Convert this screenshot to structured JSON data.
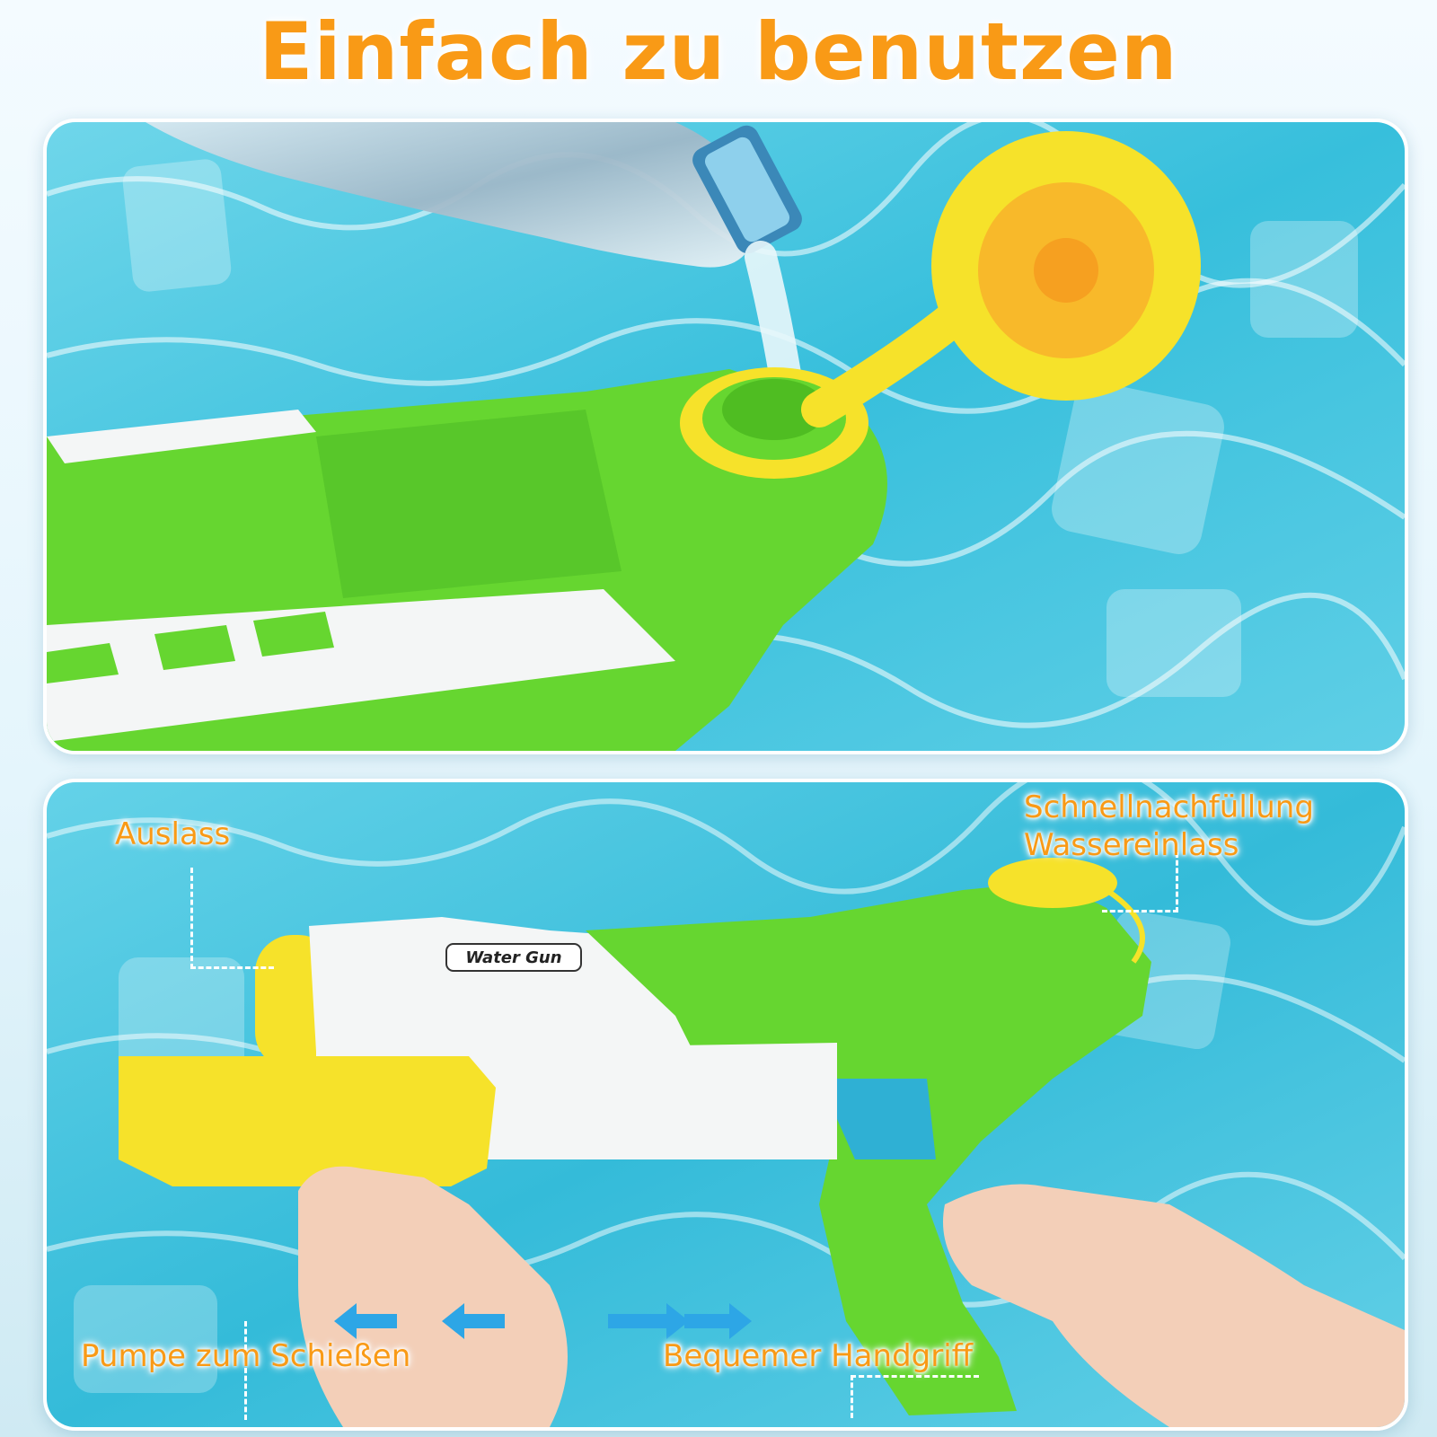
{
  "title": "Einfach zu benutzen",
  "badge_text": "Water Gun",
  "labels": {
    "outlet": "Auslass",
    "refill_line1": "Schnellnachfüllung",
    "refill_line2": "Wassereinlass",
    "pump": "Pumpe zum Schießen",
    "handle": "Bequemer Handgriff"
  },
  "colors": {
    "title": "#f99a16",
    "pool_water": "#3cc0dc",
    "gun_green": "#66d630",
    "gun_white": "#f4f6f6",
    "gun_yellow": "#f6e22a",
    "arrow_blue": "#2da6e6"
  },
  "icons": {
    "pump_arrows": "double-headed-horizontal-arrows"
  }
}
